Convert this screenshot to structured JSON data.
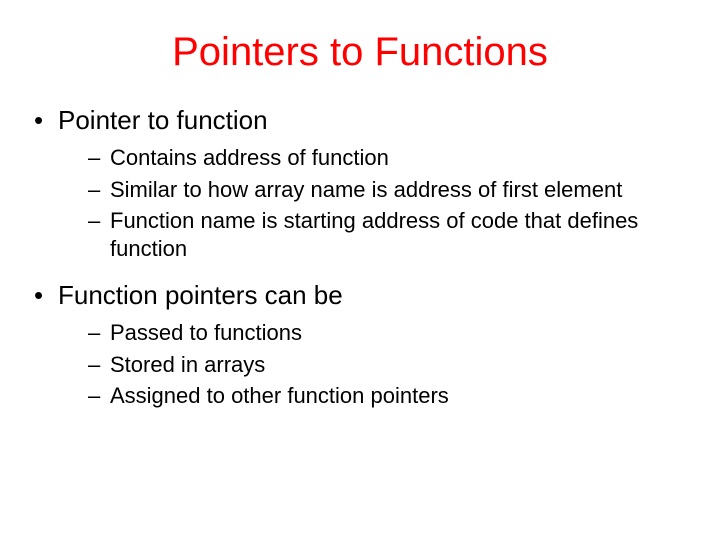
{
  "title": "Pointers to Functions",
  "sections": [
    {
      "heading": "Pointer to function",
      "items": [
        "Contains address of function",
        "Similar to how array name is address of first element",
        "Function name is starting address of code that defines function"
      ]
    },
    {
      "heading": "Function pointers can be",
      "items": [
        "Passed to functions",
        "Stored in arrays",
        "Assigned to other function pointers"
      ]
    }
  ]
}
